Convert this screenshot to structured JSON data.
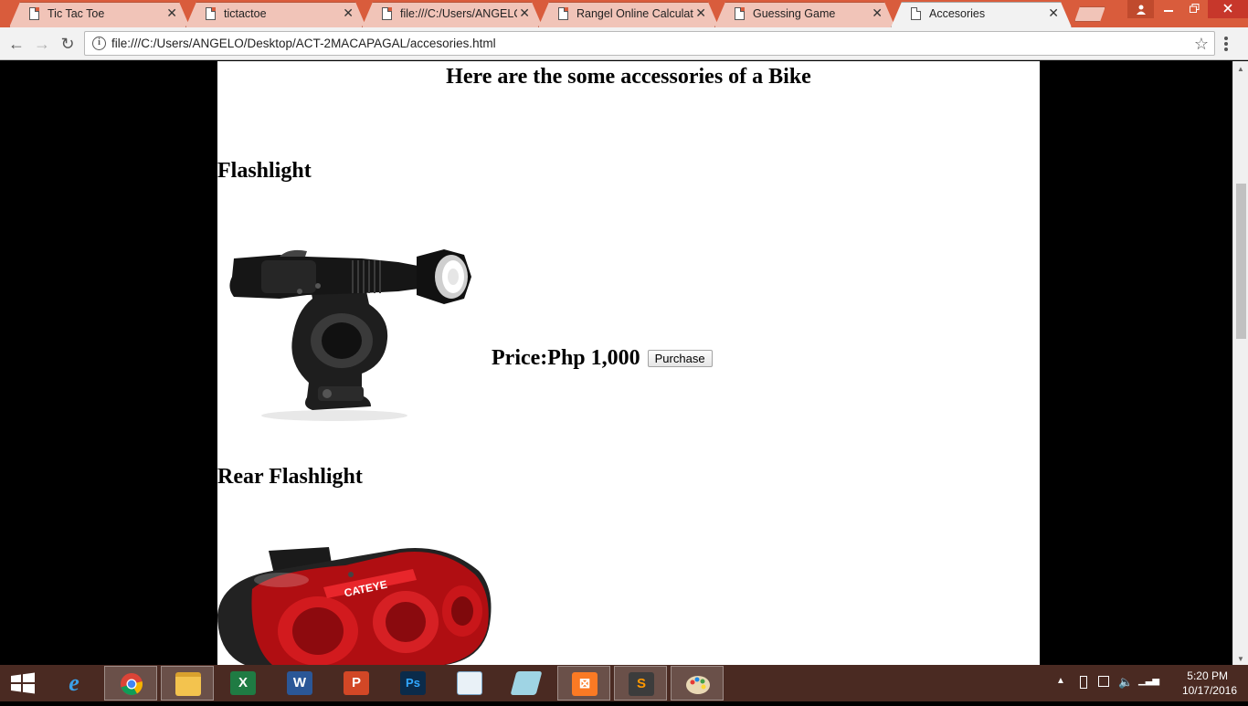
{
  "browser": {
    "tabs": [
      {
        "label": "Tic Tac Toe",
        "active": false
      },
      {
        "label": "tictactoe",
        "active": false
      },
      {
        "label": "file:///C:/Users/ANGELO/",
        "active": false
      },
      {
        "label": "Rangel Online Calculator",
        "active": false
      },
      {
        "label": "Guessing Game",
        "active": false
      },
      {
        "label": "Accesories",
        "active": true
      }
    ],
    "url": "file:///C:/Users/ANGELO/Desktop/ACT-2MACAPAGAL/accesories.html",
    "tab_close_glyph": "✕",
    "back_glyph": "←",
    "forward_glyph": "→",
    "reload_glyph": "↻",
    "star_glyph": "☆",
    "info_glyph": "i"
  },
  "page": {
    "title": "Here are the some accessories of a Bike",
    "items": [
      {
        "heading": "Flashlight",
        "price": "Price:Php 1,000",
        "button": "Purchase"
      },
      {
        "heading": "Rear Flashlight"
      }
    ],
    "rear_light_brand": "CATEYE"
  },
  "taskbar": {
    "apps": [
      "internet-explorer",
      "chrome",
      "file-explorer",
      "excel",
      "word",
      "powerpoint",
      "photoshop",
      "mysql-installer",
      "notepad",
      "xampp",
      "sublime-text",
      "paint"
    ],
    "clock_time": "5:20 PM",
    "clock_date": "10/17/2016"
  },
  "colors": {
    "titlebar": "#d95c3c",
    "taskbar": "#4a2a22",
    "page_bg": "#000000",
    "content_bg": "#ffffff"
  }
}
